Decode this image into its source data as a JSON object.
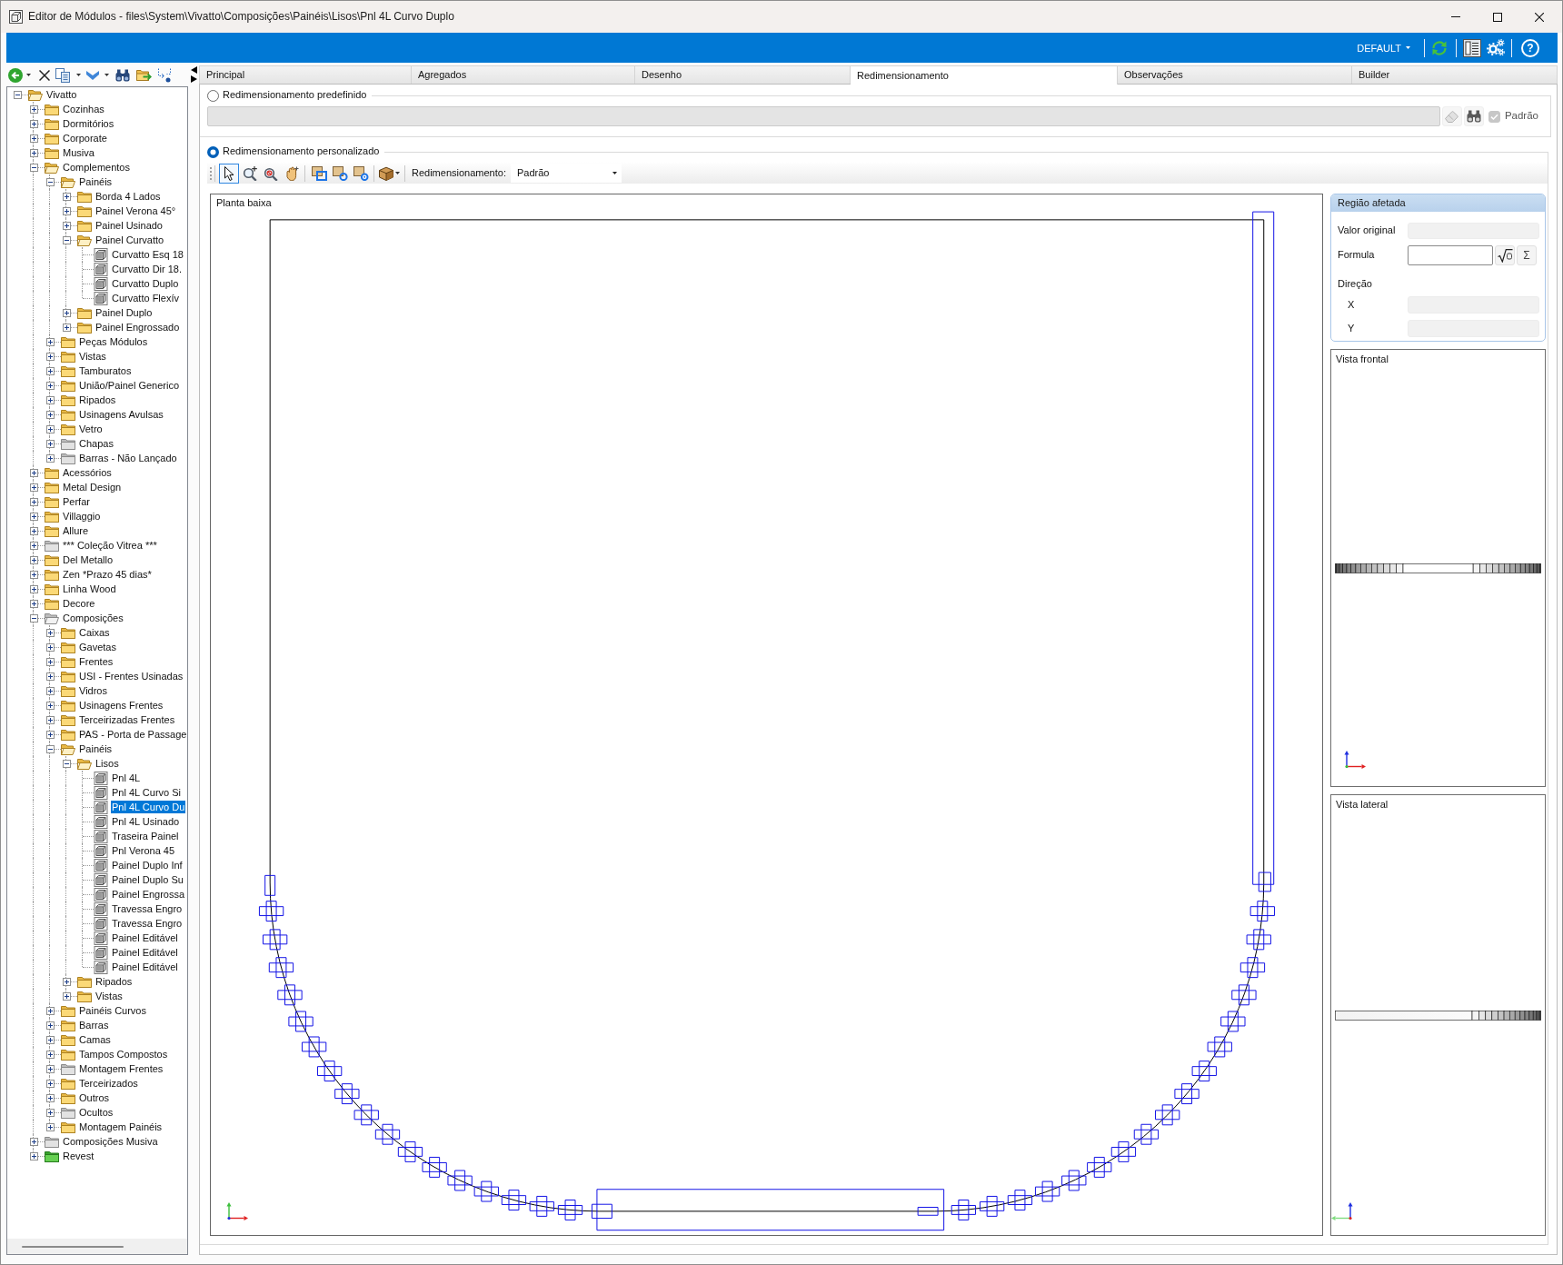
{
  "window": {
    "title": "Editor de Módulos - files\\System\\Vivatto\\Composições\\Painéis\\Lisos\\Pnl 4L Curvo Duplo"
  },
  "header_bar": {
    "profile": "DEFAULT",
    "help": "?"
  },
  "tree": [
    {
      "label": "Vivatto",
      "kind": "folder",
      "expanded": true,
      "selected": false,
      "children": [
        {
          "label": "Cozinhas",
          "kind": "folder",
          "expanded": false,
          "selected": false
        },
        {
          "label": "Dormitórios",
          "kind": "folder",
          "expanded": false,
          "selected": false
        },
        {
          "label": "Corporate",
          "kind": "folder",
          "expanded": false,
          "selected": false
        },
        {
          "label": "Musiva",
          "kind": "folder",
          "expanded": false,
          "selected": false
        },
        {
          "label": "Complementos",
          "kind": "folder",
          "expanded": true,
          "selected": false,
          "children": [
            {
              "label": "Painéis",
              "kind": "folder",
              "expanded": true,
              "selected": false,
              "children": [
                {
                  "label": "Borda 4 Lados",
                  "kind": "folder",
                  "expanded": false,
                  "selected": false
                },
                {
                  "label": "Painel Verona 45°",
                  "kind": "folder",
                  "expanded": false,
                  "selected": false
                },
                {
                  "label": "Painel Usinado",
                  "kind": "folder",
                  "expanded": false,
                  "selected": false
                },
                {
                  "label": "Painel Curvatto",
                  "kind": "folder",
                  "expanded": true,
                  "selected": false,
                  "children": [
                    {
                      "label": "Curvatto Esq 18",
                      "kind": "module",
                      "selected": false
                    },
                    {
                      "label": "Curvatto Dir 18.",
                      "kind": "module",
                      "selected": false
                    },
                    {
                      "label": "Curvatto Duplo",
                      "kind": "module",
                      "selected": false
                    },
                    {
                      "label": "Curvatto Flexív",
                      "kind": "module",
                      "selected": false
                    }
                  ]
                },
                {
                  "label": "Painel Duplo",
                  "kind": "folder",
                  "expanded": false,
                  "selected": false
                },
                {
                  "label": "Painel Engrossado",
                  "kind": "folder",
                  "expanded": false,
                  "selected": false
                }
              ]
            },
            {
              "label": "Peças Módulos",
              "kind": "folder",
              "expanded": false,
              "selected": false
            },
            {
              "label": "Vistas",
              "kind": "folder",
              "expanded": false,
              "selected": false
            },
            {
              "label": "Tamburatos",
              "kind": "folder",
              "expanded": false,
              "selected": false
            },
            {
              "label": "União/Painel Generico",
              "kind": "folder",
              "expanded": false,
              "selected": false
            },
            {
              "label": "Ripados",
              "kind": "folder",
              "expanded": false,
              "selected": false
            },
            {
              "label": "Usinagens Avulsas",
              "kind": "folder",
              "expanded": false,
              "selected": false
            },
            {
              "label": "Vetro",
              "kind": "folder",
              "expanded": false,
              "selected": false
            },
            {
              "label": "Chapas",
              "kind": "grayfolder",
              "expanded": false,
              "selected": false
            },
            {
              "label": "Barras - Não Lançado",
              "kind": "grayfolder",
              "expanded": false,
              "selected": false
            }
          ]
        },
        {
          "label": "Acessórios",
          "kind": "folder",
          "expanded": false,
          "selected": false
        },
        {
          "label": "Metal Design",
          "kind": "folder",
          "expanded": false,
          "selected": false
        },
        {
          "label": "Perfar",
          "kind": "folder",
          "expanded": false,
          "selected": false
        },
        {
          "label": "Villaggio",
          "kind": "folder",
          "expanded": false,
          "selected": false
        },
        {
          "label": "Allure",
          "kind": "folder",
          "expanded": false,
          "selected": false
        },
        {
          "label": "*** Coleção Vitrea ***",
          "kind": "grayfolder",
          "expanded": false,
          "selected": false
        },
        {
          "label": "Del Metallo",
          "kind": "folder",
          "expanded": false,
          "selected": false
        },
        {
          "label": "Zen *Prazo 45 dias*",
          "kind": "folder",
          "expanded": false,
          "selected": false
        },
        {
          "label": "Linha Wood",
          "kind": "folder",
          "expanded": false,
          "selected": false
        },
        {
          "label": "Decore",
          "kind": "folder",
          "expanded": false,
          "selected": false
        },
        {
          "label": "Composições",
          "kind": "grayfolder",
          "expanded": true,
          "selected": false,
          "children": [
            {
              "label": "Caixas",
              "kind": "folder",
              "expanded": false,
              "selected": false
            },
            {
              "label": "Gavetas",
              "kind": "folder",
              "expanded": false,
              "selected": false
            },
            {
              "label": "Frentes",
              "kind": "folder",
              "expanded": false,
              "selected": false
            },
            {
              "label": "USI - Frentes Usinadas",
              "kind": "folder",
              "expanded": false,
              "selected": false
            },
            {
              "label": "Vidros",
              "kind": "folder",
              "expanded": false,
              "selected": false
            },
            {
              "label": "Usinagens Frentes",
              "kind": "folder",
              "expanded": false,
              "selected": false
            },
            {
              "label": "Terceirizadas Frentes",
              "kind": "folder",
              "expanded": false,
              "selected": false
            },
            {
              "label": "PAS - Porta de Passage",
              "kind": "folder",
              "expanded": false,
              "selected": false
            },
            {
              "label": "Painéis",
              "kind": "folder",
              "expanded": true,
              "selected": false,
              "children": [
                {
                  "label": "Lisos",
                  "kind": "folder",
                  "expanded": true,
                  "selected": false,
                  "children": [
                    {
                      "label": "Pnl 4L",
                      "kind": "module",
                      "selected": false
                    },
                    {
                      "label": "Pnl 4L Curvo Si",
                      "kind": "module",
                      "selected": false
                    },
                    {
                      "label": "Pnl 4L Curvo Du",
                      "kind": "module",
                      "selected": true
                    },
                    {
                      "label": "Pnl 4L Usinado",
                      "kind": "module",
                      "selected": false
                    },
                    {
                      "label": "Traseira Painel",
                      "kind": "module",
                      "selected": false
                    },
                    {
                      "label": "Pnl Verona 45",
                      "kind": "module",
                      "selected": false
                    },
                    {
                      "label": "Painel Duplo Inf",
                      "kind": "module",
                      "selected": false
                    },
                    {
                      "label": "Painel Duplo Su",
                      "kind": "module",
                      "selected": false
                    },
                    {
                      "label": "Painel Engrossa",
                      "kind": "module",
                      "selected": false
                    },
                    {
                      "label": "Travessa Engro",
                      "kind": "module",
                      "selected": false
                    },
                    {
                      "label": "Travessa Engro",
                      "kind": "module",
                      "selected": false
                    },
                    {
                      "label": "Painel Editável",
                      "kind": "module",
                      "selected": false
                    },
                    {
                      "label": "Painel Editável",
                      "kind": "module",
                      "selected": false
                    },
                    {
                      "label": "Painel Editável",
                      "kind": "module",
                      "selected": false
                    }
                  ]
                },
                {
                  "label": "Ripados",
                  "kind": "folder",
                  "expanded": false,
                  "selected": false
                },
                {
                  "label": "Vistas",
                  "kind": "folder",
                  "expanded": false,
                  "selected": false
                }
              ]
            },
            {
              "label": "Painéis Curvos",
              "kind": "folder",
              "expanded": false,
              "selected": false
            },
            {
              "label": "Barras",
              "kind": "folder",
              "expanded": false,
              "selected": false
            },
            {
              "label": "Camas",
              "kind": "folder",
              "expanded": false,
              "selected": false
            },
            {
              "label": "Tampos Compostos",
              "kind": "folder",
              "expanded": false,
              "selected": false
            },
            {
              "label": "Montagem Frentes",
              "kind": "grayfolder",
              "expanded": false,
              "selected": false
            },
            {
              "label": "Terceirizados",
              "kind": "folder",
              "expanded": false,
              "selected": false
            },
            {
              "label": "Outros",
              "kind": "folder",
              "expanded": false,
              "selected": false
            },
            {
              "label": "Ocultos",
              "kind": "grayfolder",
              "expanded": false,
              "selected": false
            },
            {
              "label": "Montagem Painéis",
              "kind": "folder",
              "expanded": false,
              "selected": false
            }
          ]
        },
        {
          "label": "Composições Musiva",
          "kind": "grayfolder",
          "expanded": false,
          "selected": false
        },
        {
          "label": "Revest",
          "kind": "greenfolder",
          "expanded": false,
          "selected": false
        }
      ]
    }
  ],
  "tabs": [
    {
      "label": "Principal",
      "selected": false
    },
    {
      "label": "Agregados",
      "selected": false
    },
    {
      "label": "Desenho",
      "selected": false
    },
    {
      "label": "Redimensionamento",
      "selected": true
    },
    {
      "label": "Observações",
      "selected": false
    },
    {
      "label": "Builder",
      "selected": false
    }
  ],
  "predefined": {
    "label": "Redimensionamento predefinido",
    "selected": false,
    "default_option": {
      "label": "Padrão",
      "checked": true,
      "disabled": true
    }
  },
  "custom": {
    "label": "Redimensionamento personalizado",
    "selected": true,
    "tool_groups": [
      [
        {
          "kind": "pointer",
          "selected": true
        },
        {
          "kind": "zoomin",
          "selected": false
        },
        {
          "kind": "zoomout",
          "selected": false
        },
        {
          "kind": "pan",
          "selected": false
        }
      ],
      [
        {
          "kind": "square",
          "selected": false
        },
        {
          "kind": "circle",
          "selected": false
        },
        {
          "kind": "ring",
          "selected": false
        }
      ]
    ],
    "resize_label": "Redimensionamento:",
    "resize_value": "Padrão",
    "plan_view": {
      "title": "Planta baixa"
    }
  },
  "affected_region": {
    "title": "Região afetada",
    "original_value_label": "Valor original",
    "formula_label": "Formula",
    "sum_button": "Σ",
    "direction_label": "Direção",
    "axes": [
      "X",
      "Y"
    ]
  },
  "front_view": {
    "title": "Vista frontal"
  },
  "side_view": {
    "title": "Vista lateral"
  }
}
